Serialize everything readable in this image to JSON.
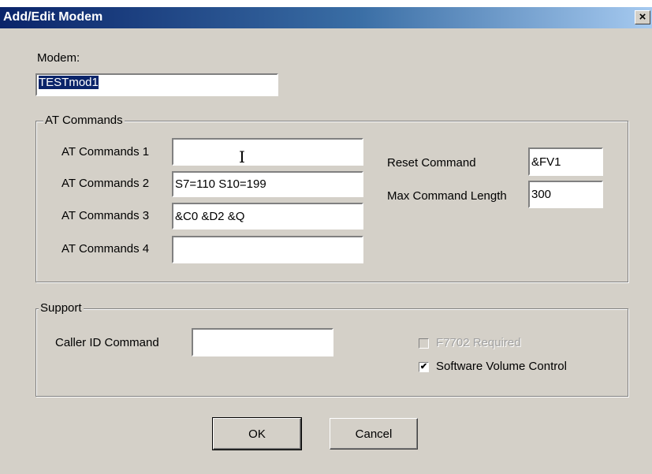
{
  "window": {
    "title": "Add/Edit Modem",
    "close_glyph": "×"
  },
  "modem": {
    "label": "Modem:",
    "value": "TESTmod1"
  },
  "at_group": {
    "legend": "AT Commands",
    "fields": [
      {
        "label": "AT Commands 1",
        "value": ""
      },
      {
        "label": "AT Commands 2",
        "value": "S7=110 S10=199"
      },
      {
        "label": "AT Commands 3",
        "value": "&C0 &D2 &Q"
      },
      {
        "label": "AT Commands 4",
        "value": ""
      }
    ],
    "reset": {
      "label": "Reset Command",
      "value": "&FV1"
    },
    "maxlen": {
      "label": "Max Command Length",
      "value": "300"
    }
  },
  "support_group": {
    "legend": "Support",
    "caller_id": {
      "label": "Caller ID Command",
      "value": ""
    },
    "f7702": {
      "label": "F7702 Required",
      "checked": false,
      "enabled": false
    },
    "volume": {
      "label": "Software Volume Control",
      "checked": true,
      "enabled": true
    }
  },
  "buttons": {
    "ok": "OK",
    "cancel": "Cancel"
  },
  "icons": {
    "close": "close-icon",
    "cursor": "i-beam-cursor-icon"
  },
  "colors": {
    "titlebar_start": "#0a246a",
    "titlebar_end": "#a6caf0",
    "face": "#d4d0c8",
    "selection": "#0a246a"
  }
}
